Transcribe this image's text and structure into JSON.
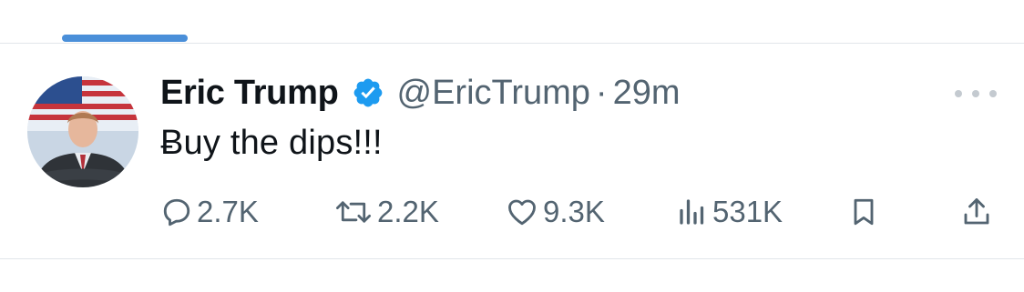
{
  "tweet": {
    "author_name": "Eric Trump",
    "handle": "@EricTrump",
    "separator": "·",
    "time": "29m",
    "text": "Ƀuy the dips!!!",
    "stats": {
      "replies": "2.7K",
      "reposts": "2.2K",
      "likes": "9.3K",
      "views": "531K"
    }
  },
  "icons": {
    "verified": "verified-badge-icon",
    "more": "more-options-icon",
    "reply": "reply-icon",
    "repost": "repost-icon",
    "like": "heart-icon",
    "views": "views-chart-icon",
    "bookmark": "bookmark-icon",
    "share": "share-icon"
  },
  "colors": {
    "accent": "#1d9bf0",
    "tab_indicator": "#4a8fd9",
    "secondary_text": "#536471",
    "divider": "#e2e6ea"
  }
}
